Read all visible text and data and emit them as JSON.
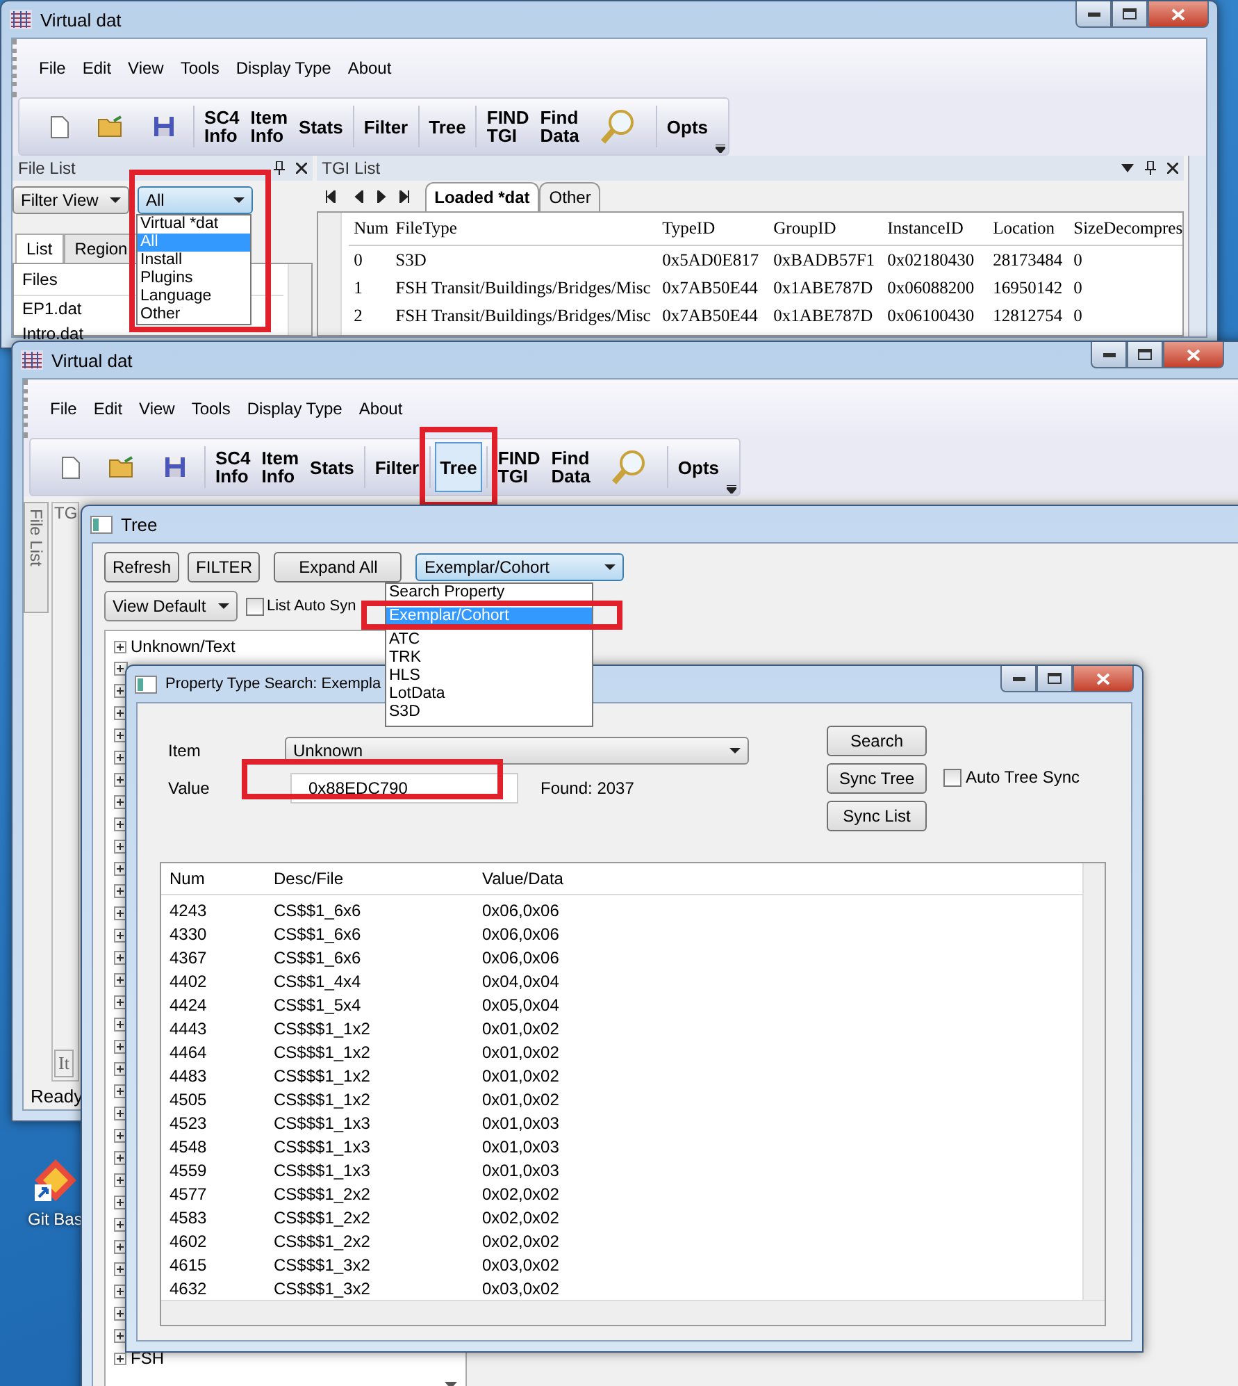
{
  "main_window": {
    "title": "Virtual dat",
    "menu": [
      "File",
      "Edit",
      "View",
      "Tools",
      "Display Type",
      "About"
    ],
    "toolbar": [
      {
        "kind": "page",
        "pressed": false
      },
      {
        "kind": "folder",
        "pressed": false
      },
      {
        "kind": "disk",
        "pressed": false
      },
      {
        "kind": "separator"
      },
      {
        "kind": "text",
        "label": "SC4\nInfo",
        "pressed": false
      },
      {
        "kind": "text",
        "label": "Item\nInfo",
        "pressed": false
      },
      {
        "kind": "text",
        "label": "Stats",
        "pressed": false
      },
      {
        "kind": "separator"
      },
      {
        "kind": "text",
        "label": "Filter",
        "pressed": false
      },
      {
        "kind": "separator"
      },
      {
        "kind": "text",
        "label": "Tree",
        "pressed": false
      },
      {
        "kind": "separator"
      },
      {
        "kind": "text",
        "label": "FIND\nTGI",
        "pressed": false
      },
      {
        "kind": "text",
        "label": "Find\nData",
        "pressed": false
      },
      {
        "kind": "magnifier",
        "pressed": false
      },
      {
        "kind": "separator"
      },
      {
        "kind": "text",
        "label": "Opts",
        "pressed": false
      }
    ],
    "file_list": {
      "title": "File List",
      "filter_combo": "Filter View",
      "view_combo": "All",
      "dropdown": [
        {
          "label": "Virtual *dat",
          "selected": false
        },
        {
          "label": "All",
          "selected": true
        },
        {
          "label": "Install",
          "selected": false
        },
        {
          "label": "Plugins",
          "selected": false
        },
        {
          "label": "Language",
          "selected": false
        },
        {
          "label": "Other",
          "selected": false
        }
      ],
      "tabs": [
        {
          "label": "List",
          "selected": true
        },
        {
          "label": "Region",
          "selected": false
        }
      ],
      "header": "Files",
      "files": [
        "EP1.dat",
        "Intro.dat"
      ]
    },
    "tgi_list": {
      "title": "TGI List",
      "tabs": [
        {
          "label": "Loaded *dat",
          "selected": true
        },
        {
          "label": "Other",
          "selected": false
        }
      ],
      "columns": [
        "Num",
        "FileType",
        "TypeID",
        "GroupID",
        "InstanceID",
        "Location",
        "SizeDecompres"
      ],
      "rows": [
        [
          "0",
          "S3D",
          "0x5AD0E817",
          "0xBADB57F1",
          "0x02180430",
          "28173484",
          "0"
        ],
        [
          "1",
          "FSH Transit/Buildings/Bridges/Misc",
          "0x7AB50E44",
          "0x1ABE787D",
          "0x06088200",
          "16950142",
          "0"
        ],
        [
          "2",
          "FSH Transit/Buildings/Bridges/Misc",
          "0x7AB50E44",
          "0x1ABE787D",
          "0x06100430",
          "12812754",
          "0"
        ]
      ]
    }
  },
  "second_window": {
    "title": "Virtual dat",
    "menu": [
      "File",
      "Edit",
      "View",
      "Tools",
      "Display Type",
      "About"
    ],
    "toolbar": [
      {
        "kind": "page",
        "pressed": false
      },
      {
        "kind": "folder",
        "pressed": false
      },
      {
        "kind": "disk",
        "pressed": false
      },
      {
        "kind": "separator"
      },
      {
        "kind": "text",
        "label": "SC4\nInfo",
        "pressed": false
      },
      {
        "kind": "text",
        "label": "Item\nInfo",
        "pressed": false
      },
      {
        "kind": "text",
        "label": "Stats",
        "pressed": false
      },
      {
        "kind": "separator"
      },
      {
        "kind": "text",
        "label": "Filter",
        "pressed": false
      },
      {
        "kind": "separator"
      },
      {
        "kind": "text",
        "label": "Tree",
        "pressed": true
      },
      {
        "kind": "separator"
      },
      {
        "kind": "text",
        "label": "FIND\nTGI",
        "pressed": false
      },
      {
        "kind": "text",
        "label": "Find\nData",
        "pressed": false
      },
      {
        "kind": "magnifier",
        "pressed": false
      },
      {
        "kind": "separator"
      },
      {
        "kind": "text",
        "label": "Opts",
        "pressed": false
      }
    ],
    "side_tab": "File List",
    "pane_stub": "TG",
    "bottom_tab": "It",
    "status_bar": "Ready"
  },
  "desktop_icon": {
    "label": "Git Bas"
  },
  "tree_window": {
    "title": "Tree",
    "buttons": [
      "Refresh",
      "FILTER",
      "Expand All"
    ],
    "view_combo": "View Default",
    "auto_sync": {
      "label": "List Auto Syn",
      "checked": false
    },
    "type_combo": "Exemplar/Cohort",
    "type_options": [
      {
        "label": "Search Property",
        "selected": false
      },
      {
        "label": "Exemplar/Cohort",
        "selected": true
      },
      {
        "label": "ATC",
        "selected": false
      },
      {
        "label": "TRK",
        "selected": false
      },
      {
        "label": "HLS",
        "selected": false
      },
      {
        "label": "LotData",
        "selected": false
      },
      {
        "label": "S3D",
        "selected": false
      }
    ],
    "tree_top": [
      "Unknown/Text"
    ],
    "tree_bottom": [
      "FSH"
    ]
  },
  "search_window": {
    "title": "Property Type Search: Exempla",
    "item_label": "Item",
    "item_combo": "Unknown",
    "value_label": "Value",
    "value": "0x88EDC790",
    "found": "Found: 2037",
    "buttons": [
      "Search",
      "Sync Tree",
      "Sync List"
    ],
    "auto_sync": {
      "label": "Auto Tree Sync",
      "checked": false
    },
    "columns": [
      "Num",
      "Desc/File",
      "Value/Data"
    ],
    "rows": [
      [
        "4243",
        "CS$$1_6x6",
        "0x06,0x06"
      ],
      [
        "4330",
        "CS$$1_6x6",
        "0x06,0x06"
      ],
      [
        "4367",
        "CS$$1_6x6",
        "0x06,0x06"
      ],
      [
        "4402",
        "CS$$1_4x4",
        "0x04,0x04"
      ],
      [
        "4424",
        "CS$$1_5x4",
        "0x05,0x04"
      ],
      [
        "4443",
        "CS$$$1_1x2",
        "0x01,0x02"
      ],
      [
        "4464",
        "CS$$$1_1x2",
        "0x01,0x02"
      ],
      [
        "4483",
        "CS$$$1_1x2",
        "0x01,0x02"
      ],
      [
        "4505",
        "CS$$$1_1x2",
        "0x01,0x02"
      ],
      [
        "4523",
        "CS$$$1_1x3",
        "0x01,0x03"
      ],
      [
        "4548",
        "CS$$$1_1x3",
        "0x01,0x03"
      ],
      [
        "4559",
        "CS$$$1_1x3",
        "0x01,0x03"
      ],
      [
        "4577",
        "CS$$$1_2x2",
        "0x02,0x02"
      ],
      [
        "4583",
        "CS$$$1_2x2",
        "0x02,0x02"
      ],
      [
        "4602",
        "CS$$$1_2x2",
        "0x02,0x02"
      ],
      [
        "4615",
        "CS$$$1_3x2",
        "0x03,0x02"
      ],
      [
        "4632",
        "CS$$$1_3x2",
        "0x03,0x02"
      ]
    ]
  }
}
